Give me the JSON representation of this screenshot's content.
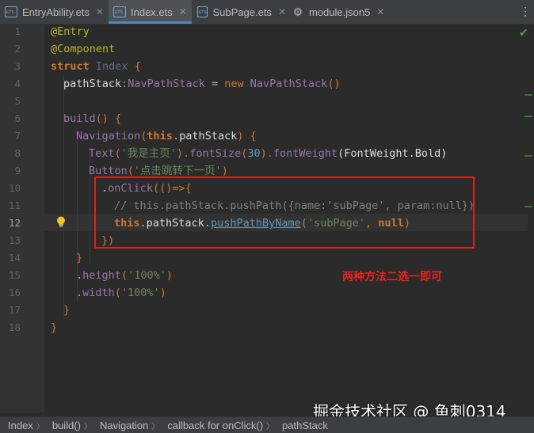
{
  "tabs": [
    {
      "label": "EntryAbility.ets",
      "icon": "ets-file-icon",
      "active": false
    },
    {
      "label": "Index.ets",
      "icon": "ets-file-icon",
      "active": true
    },
    {
      "label": "SubPage.ets",
      "icon": "ets-file-icon",
      "active": false
    },
    {
      "label": "module.json5",
      "icon": "json-file-icon",
      "active": false
    }
  ],
  "line_numbers": [
    "1",
    "2",
    "3",
    "4",
    "5",
    "6",
    "7",
    "8",
    "9",
    "10",
    "11",
    "12",
    "13",
    "14",
    "15",
    "16",
    "17",
    "18"
  ],
  "current_line": "12",
  "code": {
    "l1_ann": "@Entry",
    "l2_ann": "@Component",
    "l3_kw": "struct",
    "l3_name": "Index",
    "l3_brace": "{",
    "l4_field": "pathStack",
    "l4_colon": ":",
    "l4_type": "NavPathStack",
    "l4_eq": " = ",
    "l4_new": "new",
    "l4_ctor": "NavPathStack",
    "l4_parens": "()",
    "l6_fn": "build",
    "l6_rest": "() {",
    "l7_fn": "Navigation",
    "l7_open": "(",
    "l7_this": "this",
    "l7_dot": ".",
    "l7_field": "pathStack",
    "l7_close": ") {",
    "l8_fn": "Text",
    "l8_open": "(",
    "l8_str": "'我是主页'",
    "l8_mid": ").",
    "l8_fs": "fontSize",
    "l8_open2": "(",
    "l8_num": "30",
    "l8_mid2": ").",
    "l8_fw": "fontWeight",
    "l8_arg": "(FontWeight.Bold)",
    "l9_fn": "Button",
    "l9_open": "(",
    "l9_str": "'点击跳转下一页'",
    "l9_close": ")",
    "l10_dot": ".",
    "l10_fn": "onClick",
    "l10_rest": "(()=>{",
    "l11_comment": "// this.pathStack.pushPath({name:'subPage', param:null})",
    "l12_this": "this",
    "l12_dot": ".",
    "l12_field": "pathStack",
    "l12_dot2": ".",
    "l12_method": "pushPathByName",
    "l12_open": "(",
    "l12_str": "'subPage'",
    "l12_comma": ", ",
    "l12_null": "null",
    "l12_close": ")",
    "l13": "})",
    "l14": "}",
    "l15_dot": ".",
    "l15_fn": "height",
    "l15_open": "(",
    "l15_str": "'100%'",
    "l15_close": ")",
    "l16_dot": ".",
    "l16_fn": "width",
    "l16_open": "(",
    "l16_str": "'100%'",
    "l16_close": ")",
    "l17": "}",
    "l18": "}"
  },
  "annotation_note": "两种方法二选一即可",
  "watermark": "掘金技术社区 @ 鱼刺0314",
  "breadcrumbs": [
    "Index",
    "build()",
    "Navigation",
    "callback for onClick()",
    "pathStack"
  ],
  "colors": {
    "annotation_red": "#e8231c",
    "tab_accent": "#4a88c7",
    "editor_bg": "#2b2b2b"
  }
}
